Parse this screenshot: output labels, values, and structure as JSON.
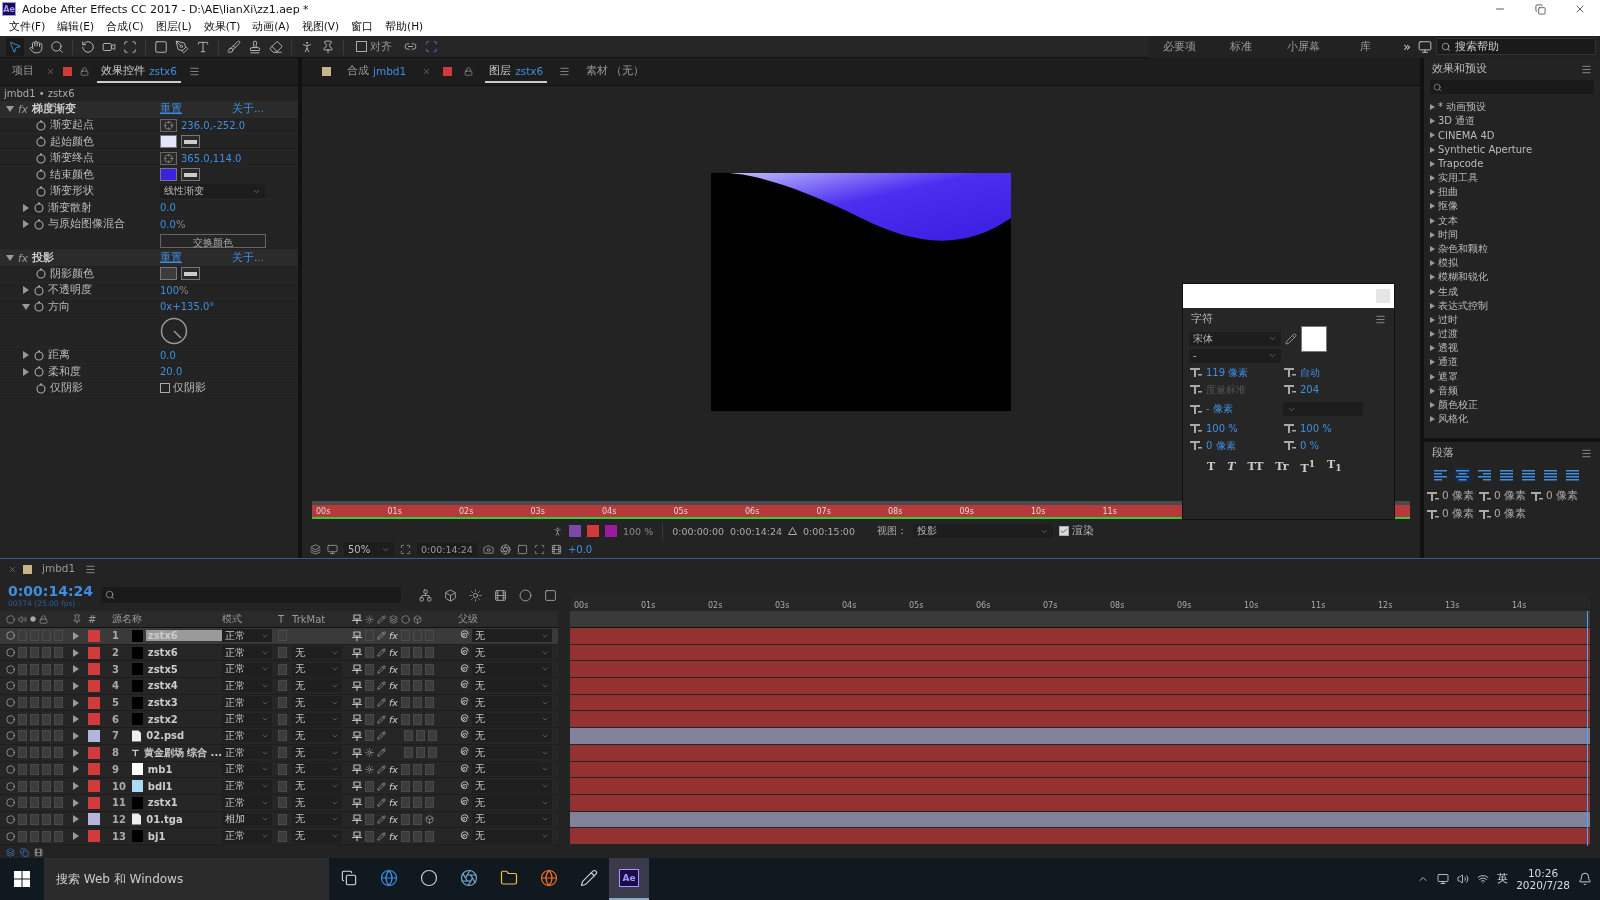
{
  "window": {
    "app_icon": "Ae",
    "title": "Adobe After Effects CC 2017 - D:\\AE\\lianXi\\zz1.aep *"
  },
  "menu": [
    "文件(F)",
    "编辑(E)",
    "合成(C)",
    "图层(L)",
    "效果(T)",
    "动画(A)",
    "视图(V)",
    "窗口",
    "帮助(H)"
  ],
  "toolbar": {
    "snap": {
      "label": "对齐",
      "checked": false
    },
    "workspaces": [
      "必要项",
      "标准",
      "小屏幕",
      "库"
    ],
    "overflow": "»",
    "search_placeholder": "搜索帮助"
  },
  "effect_controls": {
    "tabs": [
      {
        "label": "项目",
        "selected": false
      },
      {
        "label": "效果控件",
        "target": "zstx6",
        "selected": true
      }
    ],
    "breadcrumb": "jmbd1 • zstx6",
    "effects": [
      {
        "badge": "fx",
        "name": "梯度渐变",
        "expanded": true,
        "reset": "重置",
        "about": "关于...",
        "props": [
          {
            "kind": "point",
            "name": "渐变起点",
            "value": "236.0,-252.0"
          },
          {
            "kind": "color",
            "name": "起始颜色",
            "color": "#e4e6ff"
          },
          {
            "kind": "point",
            "name": "渐变终点",
            "value": "365.0,114.0"
          },
          {
            "kind": "color",
            "name": "结束颜色",
            "color": "#3b22e0"
          },
          {
            "kind": "dropdown",
            "name": "渐变形状",
            "value": "线性渐变"
          },
          {
            "kind": "number",
            "name": "渐变散射",
            "value": "0.0",
            "expanded": false
          },
          {
            "kind": "number",
            "name": "与原始图像混合",
            "value": "0.0",
            "unit": "%",
            "expanded": false
          },
          {
            "kind": "button",
            "label": "交换颜色"
          }
        ]
      },
      {
        "badge": "fx",
        "name": "投影",
        "expanded": true,
        "reset": "重置",
        "about": "关于...",
        "props": [
          {
            "kind": "color",
            "name": "阴影颜色",
            "color": "#3c3c3c"
          },
          {
            "kind": "number",
            "name": "不透明度",
            "value": "100",
            "unit": "%",
            "expanded": false
          },
          {
            "kind": "angle",
            "name": "方向",
            "value": "0x+135.0°",
            "expanded": true
          },
          {
            "kind": "number",
            "name": "距离",
            "value": "0.0",
            "expanded": false
          },
          {
            "kind": "number",
            "name": "柔和度",
            "value": "20.0",
            "expanded": false
          },
          {
            "kind": "checkbox",
            "name": "仅阴影",
            "label": "仅阴影",
            "checked": false
          }
        ]
      }
    ]
  },
  "viewer": {
    "tabs": [
      {
        "label": "合成",
        "target": "jmbd1",
        "color": "#c8b48a",
        "selected": false
      },
      {
        "label": "图层",
        "target": "zstx6",
        "color": "#d03a3a",
        "selected": true
      },
      {
        "label": "素材 （无）",
        "selected": false
      }
    ],
    "ruler": [
      "00s",
      "01s",
      "02s",
      "03s",
      "04s",
      "05s",
      "06s",
      "07s",
      "08s",
      "09s",
      "10s",
      "11s"
    ],
    "controls": {
      "opacity": "100 %",
      "in": "0:00:00:00",
      "out": "0:00:14:24",
      "duration": "0:00:15:00",
      "view_label": "视图：",
      "view": "投影",
      "render": {
        "label": "渲染",
        "checked": true
      }
    },
    "footer": {
      "zoom": "50%",
      "timecode": "0:00:14:24",
      "exposure": "+0.0"
    }
  },
  "character": {
    "title": "字符",
    "font": "宋体",
    "style": "-",
    "size": "119 像素",
    "leading": "自动",
    "kerning": "度量标准",
    "tracking": "204",
    "stroke": "- 像素",
    "vscale": "100 %",
    "hscale": "100 %",
    "baseline": "0 像素",
    "tsume": "0 %",
    "styles": [
      "T",
      "T",
      "TT",
      "Tr",
      "T$^{1}$",
      "T$_{1}$"
    ]
  },
  "presets": {
    "title": "效果和预设",
    "items": [
      "* 动画预设",
      "3D 通道",
      "CINEMA 4D",
      "Synthetic Aperture",
      "Trapcode",
      "实用工具",
      "扭曲",
      "抠像",
      "文本",
      "时间",
      "杂色和颗粒",
      "模拟",
      "模糊和锐化",
      "生成",
      "表达式控制",
      "过时",
      "过渡",
      "透视",
      "通道",
      "遮罩",
      "音频",
      "颜色校正",
      "风格化"
    ]
  },
  "paragraph": {
    "title": "段落",
    "align": [
      {
        "selected": false
      },
      {
        "selected": true
      },
      {
        "selected": false
      },
      {
        "selected": false
      },
      {
        "selected": false
      },
      {
        "selected": false
      },
      {
        "selected": false
      }
    ],
    "indents": [
      "0 像素",
      "0 像素",
      "0 像素",
      "0 像素",
      "0 像素"
    ]
  },
  "timeline": {
    "tab": "jmbd1",
    "timecode": "0:00:14:24",
    "frames": "00374 (25.00 fps)",
    "columns": {
      "num": "#",
      "name": "源名称",
      "mode": "模式",
      "t": "T",
      "trkmat": "TrkMat",
      "parent": "父级"
    },
    "ruler": [
      "00s",
      "01s",
      "02s",
      "03s",
      "04s",
      "05s",
      "06s",
      "07s",
      "08s",
      "09s",
      "10s",
      "11s",
      "12s",
      "13s",
      "14s"
    ],
    "layers": [
      {
        "num": "1",
        "name": "zstx6",
        "color": "#d13b3b",
        "thumb": {
          "kind": "solid",
          "color": "#000000"
        },
        "mode": "正常",
        "fx": "fx",
        "sun": false,
        "cube": false,
        "parent": "无",
        "selected": true
      },
      {
        "num": "2",
        "name": "zstx6",
        "color": "#d13b3b",
        "thumb": {
          "kind": "solid",
          "color": "#000000"
        },
        "mode": "正常",
        "trkmat": "无",
        "fx": "fx",
        "sun": false,
        "cube": false,
        "parent": "无",
        "selected": false
      },
      {
        "num": "3",
        "name": "zstx5",
        "color": "#d13b3b",
        "thumb": {
          "kind": "solid",
          "color": "#000000"
        },
        "mode": "正常",
        "trkmat": "无",
        "fx": "fx",
        "sun": false,
        "cube": false,
        "parent": "无",
        "selected": false
      },
      {
        "num": "4",
        "name": "zstx4",
        "color": "#d13b3b",
        "thumb": {
          "kind": "solid",
          "color": "#000000"
        },
        "mode": "正常",
        "trkmat": "无",
        "fx": "fx",
        "sun": false,
        "cube": false,
        "parent": "无",
        "selected": false
      },
      {
        "num": "5",
        "name": "zstx3",
        "color": "#d13b3b",
        "thumb": {
          "kind": "solid",
          "color": "#000000"
        },
        "mode": "正常",
        "trkmat": "无",
        "fx": "fx",
        "sun": false,
        "cube": false,
        "parent": "无",
        "selected": false
      },
      {
        "num": "6",
        "name": "zstx2",
        "color": "#d13b3b",
        "thumb": {
          "kind": "solid",
          "color": "#000000"
        },
        "mode": "正常",
        "trkmat": "无",
        "fx": "fx",
        "sun": false,
        "cube": false,
        "parent": "无",
        "selected": false
      },
      {
        "num": "7",
        "name": "02.psd",
        "color": "#b4b4dc",
        "thumb": {
          "kind": "file"
        },
        "mode": "正常",
        "trkmat": "无",
        "sun": false,
        "cube": false,
        "parent": "无",
        "selected": false
      },
      {
        "num": "8",
        "name": "黄金剧场 综合 ...",
        "color": "#d13b3b",
        "thumb": {
          "kind": "text"
        },
        "mode": "正常",
        "trkmat": "无",
        "sun": true,
        "cube": false,
        "parent": "无",
        "selected": false
      },
      {
        "num": "9",
        "name": "mb1",
        "color": "#d13b3b",
        "thumb": {
          "kind": "solid",
          "color": "#ffffff"
        },
        "mode": "正常",
        "trkmat": "无",
        "fx": "fx",
        "sun": true,
        "cube": false,
        "parent": "无",
        "selected": false
      },
      {
        "num": "10",
        "name": "bdl1",
        "color": "#d13b3b",
        "thumb": {
          "kind": "solid",
          "color": "#a8dcf4"
        },
        "mode": "正常",
        "trkmat": "无",
        "fx": "fx",
        "sun": false,
        "cube": false,
        "parent": "无",
        "selected": false
      },
      {
        "num": "11",
        "name": "zstx1",
        "color": "#d13b3b",
        "thumb": {
          "kind": "solid",
          "color": "#000000"
        },
        "mode": "正常",
        "trkmat": "无",
        "fx": "fx",
        "sun": false,
        "cube": false,
        "parent": "无",
        "selected": false
      },
      {
        "num": "12",
        "name": "01.tga",
        "color": "#b4b4dc",
        "thumb": {
          "kind": "file"
        },
        "mode": "相加",
        "trkmat": "无",
        "fx": "fx",
        "sun": false,
        "cube": true,
        "parent": "无",
        "selected": false
      },
      {
        "num": "13",
        "name": "bj1",
        "color": "#d13b3b",
        "thumb": {
          "kind": "solid",
          "color": "#000000"
        },
        "mode": "正常",
        "trkmat": "无",
        "fx": "fx",
        "sun": false,
        "cube": false,
        "parent": "无",
        "selected": false
      }
    ]
  },
  "taskbar": {
    "search": "搜索 Web 和 Windows",
    "apps": [
      {
        "kind": "task-view",
        "selected": false
      },
      {
        "kind": "edge",
        "selected": false
      },
      {
        "kind": "app",
        "selected": false
      },
      {
        "kind": "browser",
        "selected": false
      },
      {
        "kind": "folder",
        "selected": false
      },
      {
        "kind": "firefox",
        "selected": false
      },
      {
        "kind": "editor",
        "selected": false
      },
      {
        "kind": "ae",
        "label": "Ae",
        "selected": true
      }
    ],
    "ime": "英",
    "time": "10:26",
    "date": "2020/7/28"
  }
}
